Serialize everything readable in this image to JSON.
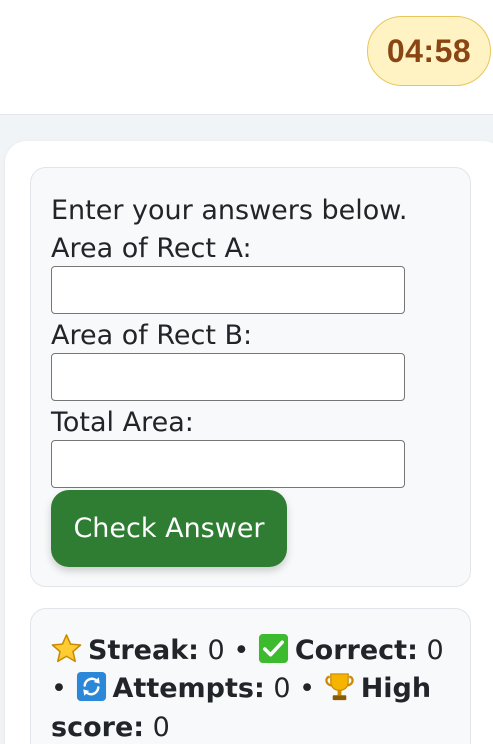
{
  "timer": {
    "label": "04:58"
  },
  "answers_panel": {
    "instructions": "Enter your answers below.",
    "fields": [
      {
        "label": "Area of Rect A:",
        "value": ""
      },
      {
        "label": "Area of Rect B:",
        "value": ""
      },
      {
        "label": "Total Area:",
        "value": ""
      }
    ],
    "check_button": "Check Answer"
  },
  "stats": {
    "streak_label": "Streak:",
    "streak_value": "0",
    "correct_label": "Correct:",
    "correct_value": "0",
    "attempts_label": "Attempts:",
    "attempts_value": "0",
    "high_label_1": "High",
    "high_label_2": "score:",
    "high_value": "0",
    "separator": "•",
    "icons": [
      "star-icon",
      "checkmark-icon",
      "refresh-icon",
      "trophy-icon"
    ]
  },
  "colors": {
    "timer_bg": "#fff3c4",
    "timer_text": "#8a4512",
    "button_bg": "#2e7d32",
    "panel_bg": "#f8f9fa"
  }
}
